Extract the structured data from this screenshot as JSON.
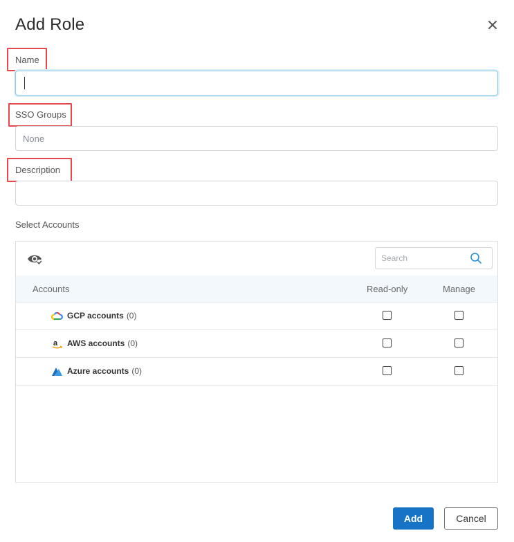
{
  "dialog": {
    "title": "Add Role"
  },
  "form": {
    "name": {
      "label": "Name",
      "value": ""
    },
    "sso_groups": {
      "label": "SSO Groups",
      "placeholder": "None"
    },
    "description": {
      "label": "Description",
      "value": ""
    },
    "select_accounts_label": "Select Accounts"
  },
  "accounts_table": {
    "search_placeholder": "Search",
    "columns": {
      "accounts": "Accounts",
      "read_only": "Read-only",
      "manage": "Manage"
    },
    "rows": [
      {
        "name": "GCP accounts",
        "count": "(0)",
        "icon": "gcp-cloud-icon"
      },
      {
        "name": "AWS accounts",
        "count": "(0)",
        "icon": "amazon-icon"
      },
      {
        "name": "Azure accounts",
        "count": "(0)",
        "icon": "azure-icon"
      }
    ]
  },
  "actions": {
    "add_label": "Add",
    "cancel_label": "Cancel"
  },
  "colors": {
    "primary": "#1673c6",
    "highlight": "#e5484d",
    "header_bg": "#f2f8fc"
  }
}
